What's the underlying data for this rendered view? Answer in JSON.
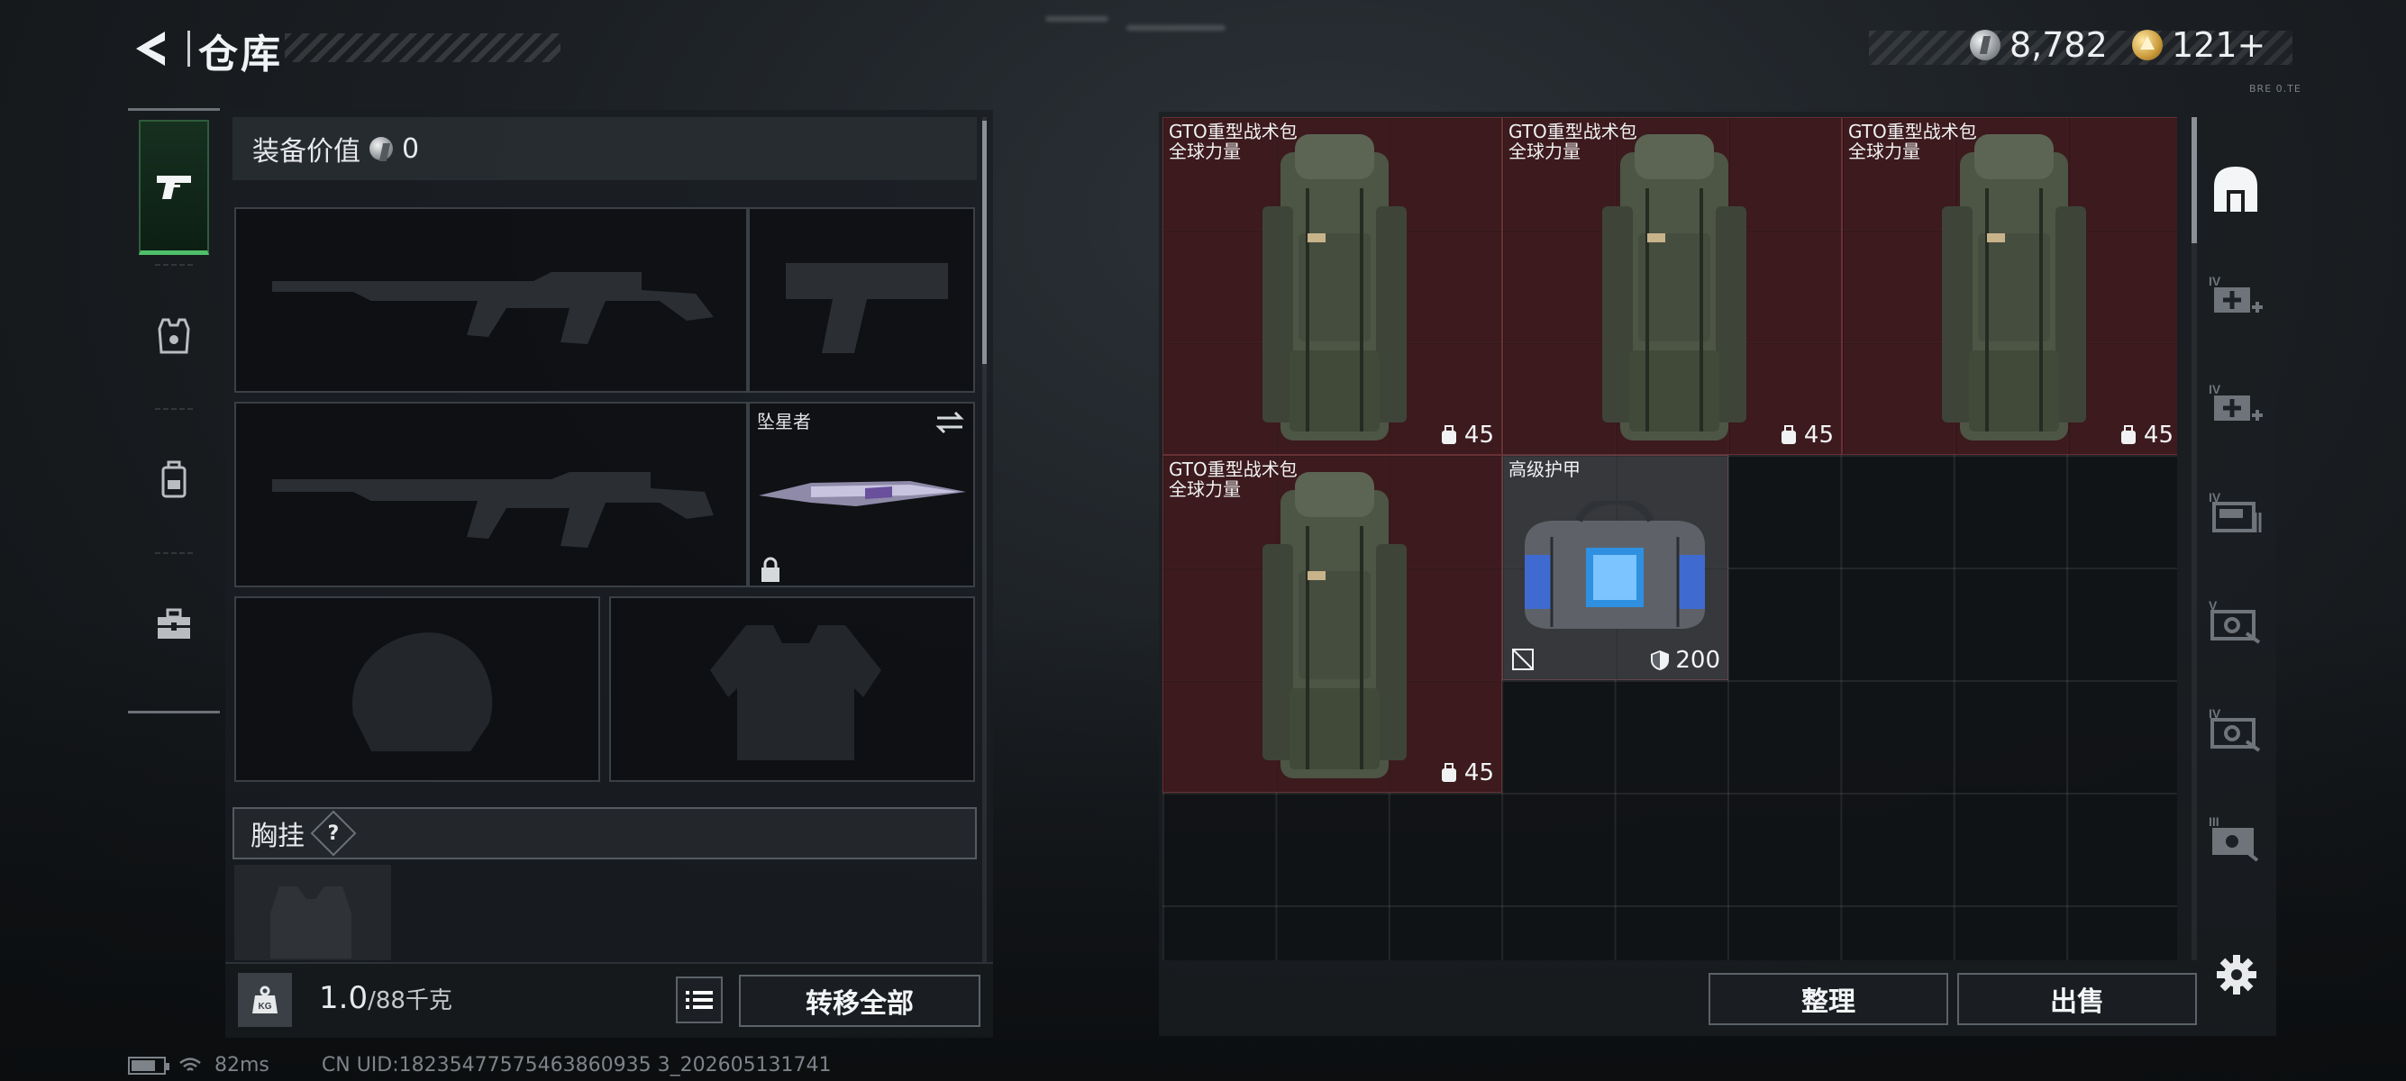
{
  "header": {
    "title": "仓库"
  },
  "currency": {
    "silver": "8,782",
    "gold": "121+"
  },
  "corner_tag": "BRE 0.TE",
  "left": {
    "value_label": "装备价值",
    "value": "0",
    "melee_slot_label": "坠星者",
    "chest_rig_label": "胸挂",
    "chest_rig_help": "?",
    "weight_value": "1.0",
    "weight_max": "/88千克",
    "transfer_all": "转移全部"
  },
  "stash_items": [
    {
      "name_line1": "GTO重型战术包",
      "name_line2": "全球力量",
      "count": "45"
    },
    {
      "name_line1": "GTO重型战术包",
      "name_line2": "全球力量",
      "count": "45"
    },
    {
      "name_line1": "GTO重型战术包",
      "name_line2": "全球力量",
      "count": "45"
    },
    {
      "name_line1": "GTO重型战术包",
      "name_line2": "全球力量",
      "count": "45"
    },
    {
      "name_line1": "高级护甲",
      "name_line2": "",
      "count": "200"
    }
  ],
  "right_buttons": {
    "sort": "整理",
    "sell": "出售"
  },
  "right_tabs": [
    "IV",
    "IV",
    "IV",
    "V",
    "IV",
    "III"
  ],
  "status_bar": {
    "ping": "82ms",
    "uid": "CN UID:18235477575463860935 3_202605131741"
  }
}
